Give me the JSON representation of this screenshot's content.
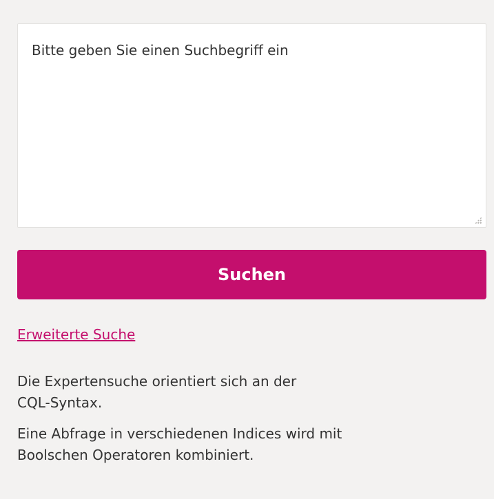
{
  "search": {
    "placeholder": "Bitte geben Sie einen Suchbegriff ein",
    "button_label": "Suchen",
    "advanced_link": "Erweiterte Suche"
  },
  "info": {
    "paragraph_1_line_1": "Die Expertensuche orientiert sich an der",
    "paragraph_1_line_2": "CQL-Syntax.",
    "paragraph_2_line_1": "Eine Abfrage in verschiedenen Indices wird mit",
    "paragraph_2_line_2": "Boolschen Operatoren kombiniert."
  },
  "colors": {
    "accent": "#c40f6d",
    "background": "#f3f2f1",
    "text": "#333333"
  }
}
